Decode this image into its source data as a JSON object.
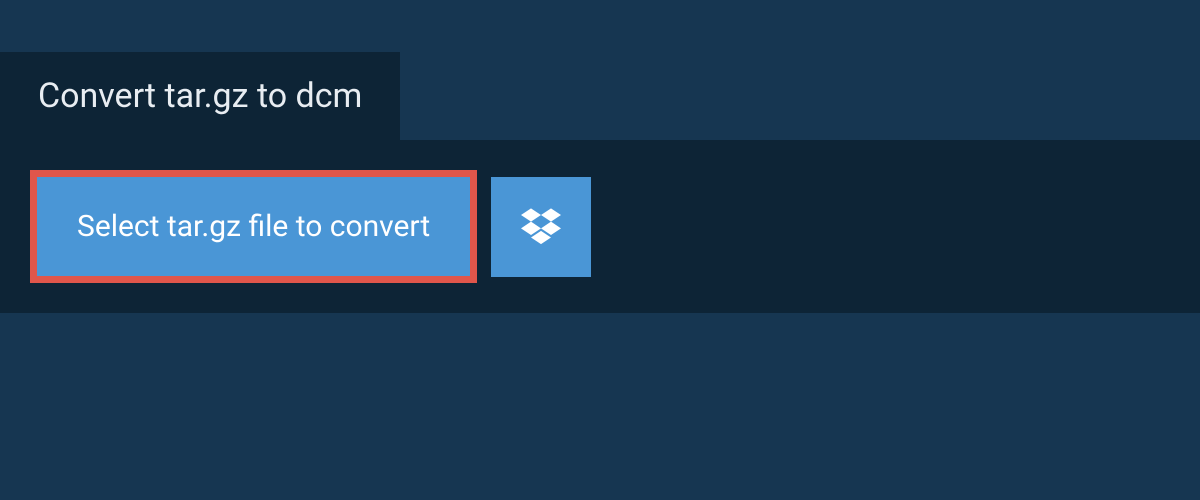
{
  "header": {
    "title": "Convert tar.gz to dcm"
  },
  "actions": {
    "select_label": "Select tar.gz file to convert",
    "dropbox_icon": "dropbox-icon"
  },
  "colors": {
    "page_bg": "#163651",
    "panel_bg": "#0d2436",
    "button_bg": "#4a96d6",
    "button_border": "#e0564b"
  }
}
